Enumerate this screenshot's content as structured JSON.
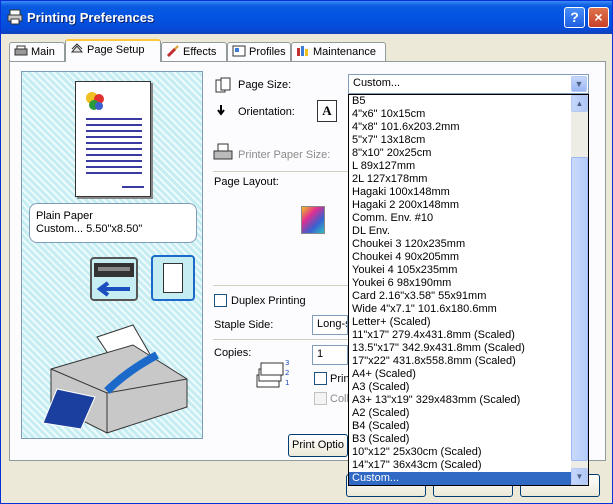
{
  "window": {
    "title": "Printing Preferences",
    "help_label": "?",
    "close_label": "×"
  },
  "tabs": [
    {
      "label": "Main"
    },
    {
      "label": "Page Setup"
    },
    {
      "label": "Effects"
    },
    {
      "label": "Profiles"
    },
    {
      "label": "Maintenance"
    }
  ],
  "preview": {
    "media_line1": "Plain Paper",
    "media_line2": "Custom... 5.50\"x8.50\""
  },
  "page_setup": {
    "page_size_label": "Page Size:",
    "page_size_value": "Custom...",
    "orientation_label": "Orientation:",
    "printer_paper_size_label": "Printer Paper Size:",
    "page_layout_label": "Page Layout:",
    "duplex_label": "Duplex Printing",
    "staple_side_label": "Staple Side:",
    "staple_side_value": "Long-s",
    "copies_label": "Copies:",
    "copies_value": "1",
    "print_label": "Prin",
    "collate_label": "Colla",
    "print_options_label": "Print Optio"
  },
  "page_size_options": [
    "B5",
    "4\"x6\" 10x15cm",
    "4\"x8\" 101.6x203.2mm",
    "5\"x7\" 13x18cm",
    "8\"x10\" 20x25cm",
    "L 89x127mm",
    "2L 127x178mm",
    "Hagaki 100x148mm",
    "Hagaki 2 200x148mm",
    "Comm. Env. #10",
    "DL Env.",
    "Choukei 3 120x235mm",
    "Choukei 4 90x205mm",
    "Youkei 4 105x235mm",
    "Youkei 6 98x190mm",
    "Card 2.16\"x3.58\" 55x91mm",
    "Wide 4\"x7.1\" 101.6x180.6mm",
    "Letter+ (Scaled)",
    "11\"x17\" 279.4x431.8mm (Scaled)",
    "13.5\"x17\" 342.9x431.8mm (Scaled)",
    "17\"x22\" 431.8x558.8mm (Scaled)",
    "A4+ (Scaled)",
    "A3 (Scaled)",
    "A3+ 13\"x19\" 329x483mm (Scaled)",
    "A2 (Scaled)",
    "B4 (Scaled)",
    "B3 (Scaled)",
    "10\"x12\" 25x30cm (Scaled)",
    "14\"x17\" 36x43cm (Scaled)",
    "Custom..."
  ],
  "selected_option_index": 29,
  "colors": {
    "titlebar": "#0a5be0",
    "selection": "#316ac5",
    "preview_bg": "#c6eef2"
  }
}
